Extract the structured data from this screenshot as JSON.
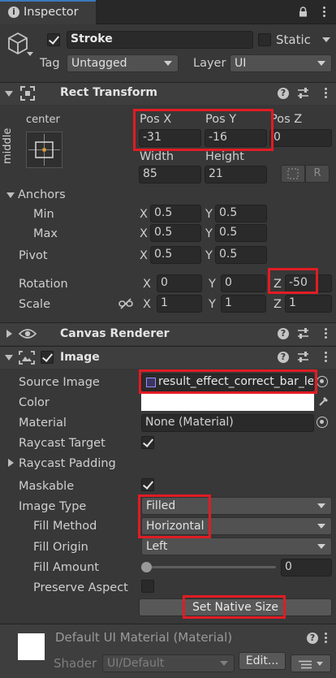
{
  "tab": {
    "title": "Inspector"
  },
  "gameobject": {
    "name": "Stroke",
    "static_label": "Static",
    "tag_label": "Tag",
    "tag_value": "Untagged",
    "layer_label": "Layer",
    "layer_value": "UI"
  },
  "rect_transform": {
    "title": "Rect Transform",
    "anchor_h": "center",
    "anchor_v": "middle",
    "pos_x_label": "Pos X",
    "pos_y_label": "Pos Y",
    "pos_z_label": "Pos Z",
    "pos_x": "-31",
    "pos_y": "-16",
    "pos_z": "0",
    "width_label": "Width",
    "height_label": "Height",
    "width": "85",
    "height": "21",
    "r_button": "R",
    "anchors_label": "Anchors",
    "min_label": "Min",
    "min_x": "0.5",
    "min_y": "0.5",
    "max_label": "Max",
    "max_x": "0.5",
    "max_y": "0.5",
    "pivot_label": "Pivot",
    "pivot_x": "0.5",
    "pivot_y": "0.5",
    "rotation_label": "Rotation",
    "rot_x": "0",
    "rot_y": "0",
    "rot_z": "-50",
    "scale_label": "Scale",
    "scale_x": "1",
    "scale_y": "1",
    "scale_z": "1",
    "x": "X",
    "y": "Y",
    "z": "Z"
  },
  "canvas_renderer": {
    "title": "Canvas Renderer"
  },
  "image": {
    "title": "Image",
    "source_label": "Source Image",
    "source_value": "result_effect_correct_bar_le",
    "color_label": "Color",
    "color_value": "#ffffff",
    "material_label": "Material",
    "material_value": "None (Material)",
    "raycast_target_label": "Raycast Target",
    "raycast_padding_label": "Raycast Padding",
    "maskable_label": "Maskable",
    "image_type_label": "Image Type",
    "image_type_value": "Filled",
    "fill_method_label": "Fill Method",
    "fill_method_value": "Horizontal",
    "fill_origin_label": "Fill Origin",
    "fill_origin_value": "Left",
    "fill_amount_label": "Fill Amount",
    "fill_amount_value": "0",
    "fill_amount": 0,
    "preserve_aspect_label": "Preserve Aspect",
    "set_native_size": "Set Native Size"
  },
  "material_footer": {
    "title": "Default UI Material (Material)",
    "shader_label": "Shader",
    "shader_value": "UI/Default",
    "edit_button": "Edit..."
  },
  "colors": {
    "highlight": "#e01c24",
    "background": "#383838",
    "field": "#2a2a2a"
  }
}
